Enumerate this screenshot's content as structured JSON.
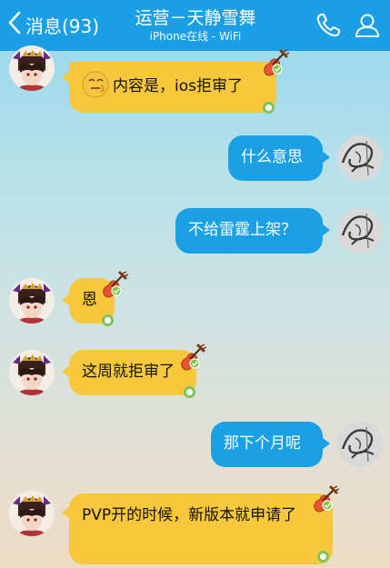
{
  "header": {
    "back_label": "消息(93)",
    "title": "运营－天静雪舞",
    "subtitle": "iPhone在线 - WiFi",
    "icons": [
      "chevron-left-icon",
      "phone-icon",
      "profile-icon"
    ]
  },
  "messages": [
    {
      "from": "contact",
      "text": "内容是，ios拒审了",
      "has_emoji": true
    },
    {
      "from": "me",
      "text": "什么意思"
    },
    {
      "from": "me",
      "text": "不给雷霆上架？"
    },
    {
      "from": "contact",
      "text": "恩"
    },
    {
      "from": "contact",
      "text": "这周就拒审了"
    },
    {
      "from": "me",
      "text": "那下个月呢"
    },
    {
      "from": "contact",
      "text": "PVP开的时候，新版本就申请了"
    }
  ],
  "colors": {
    "header": "#1a9fe6",
    "bubble_in": "#f8c83c",
    "bubble_out": "#1b9fe5"
  }
}
